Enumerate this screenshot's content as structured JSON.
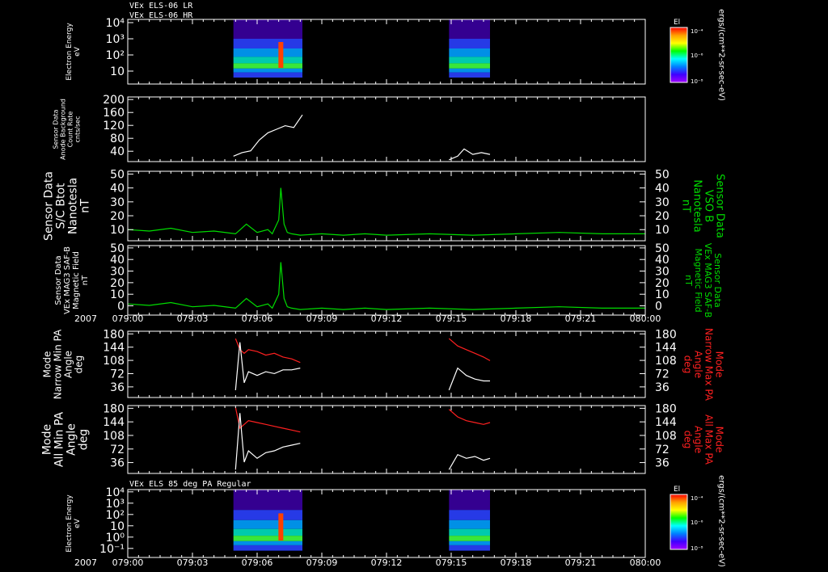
{
  "header": {
    "line1": "VEx ELS-06 LR",
    "line2": "VEx ELS-06 HR",
    "panel7_title": "VEx ELS 85 deg PA Regular"
  },
  "colors": {
    "background": "#000000",
    "axis": "#ffffff",
    "magnetic": "#00dd00",
    "max_pa": "#ff2020",
    "min_pa": "#ffffff"
  },
  "time_axis": {
    "start": "079:00",
    "end": "080:00",
    "year_label": "2007",
    "tick_labels": [
      "079:00",
      "079:03",
      "079:06",
      "079:09",
      "079:12",
      "079:15",
      "079:18",
      "079:21",
      "080:00"
    ]
  },
  "colorbar": {
    "title": "El",
    "unit": "ergs/(cm**2-sr-sec-eV)",
    "ticks": [
      "10⁻⁴",
      "10⁻⁶",
      "10⁻⁸"
    ]
  },
  "chart_data": [
    {
      "id": "p1",
      "type": "heatmap",
      "ylabel": [
        "Electron Energy",
        "eV"
      ],
      "y_ticks": [
        "10⁴",
        "10³",
        "10²",
        "10"
      ],
      "ylim": [
        1,
        20000
      ],
      "scale": "log",
      "data_intervals_minutes": [
        [
          4.9,
          8.1
        ],
        [
          14.9,
          16.8
        ]
      ]
    },
    {
      "id": "p2",
      "type": "line",
      "ylabel": [
        "Sensor Data",
        "Anode Background",
        "Count Rate",
        "cnts/sec"
      ],
      "y_ticks": [
        "200",
        "160",
        "120",
        "80",
        "40"
      ],
      "ylim": [
        20,
        200
      ],
      "series": [
        {
          "color": "#ffffff",
          "segments": [
            {
              "x": [
                4.9,
                5.3,
                5.7,
                6.1,
                6.5,
                6.9,
                7.3,
                7.7,
                8.1
              ],
              "y": [
                35,
                45,
                50,
                80,
                100,
                110,
                120,
                115,
                150
              ]
            },
            {
              "x": [
                14.9,
                15.3,
                15.6,
                16.0,
                16.4,
                16.8
              ],
              "y": [
                25,
                35,
                55,
                40,
                45,
                40
              ]
            }
          ]
        }
      ]
    },
    {
      "id": "p3",
      "type": "line",
      "ylabel": [
        "Sensor Data",
        "S/C Btot",
        "Nanotesla",
        "nT"
      ],
      "ylabel_right": [
        "Sensor Data",
        "VSO B",
        "Nanotesla",
        "nT"
      ],
      "y_ticks": [
        "50",
        "40",
        "30",
        "20",
        "10"
      ],
      "ylim": [
        0,
        50
      ],
      "series": [
        {
          "color": "#00dd00",
          "x": [
            0,
            1,
            2,
            3,
            4,
            5,
            5.5,
            6,
            6.5,
            6.7,
            7.0,
            7.1,
            7.25,
            7.4,
            7.6,
            8,
            9,
            10,
            11,
            12,
            14,
            16,
            18,
            20,
            22,
            24
          ],
          "y": [
            8,
            7,
            9,
            6,
            7,
            5,
            12,
            6,
            8,
            5,
            15,
            38,
            12,
            6,
            5,
            4,
            5,
            4,
            5,
            4,
            5,
            4,
            5,
            6,
            5,
            5
          ]
        }
      ]
    },
    {
      "id": "p4",
      "type": "line",
      "ylabel": [
        "Sensor Data",
        "VEx MAG3 SAF-B",
        "Magnetic Field",
        "nT"
      ],
      "ylabel_right": [
        "Sensor Data",
        "VEx MAG3 SAF-B",
        "Magnetic Field",
        "nT"
      ],
      "y_ticks": [
        "50",
        "40",
        "30",
        "20",
        "10",
        "0"
      ],
      "ylim": [
        0,
        50
      ],
      "series": [
        {
          "color": "#00dd00",
          "x": [
            0,
            1,
            2,
            3,
            4,
            5,
            5.5,
            6,
            6.5,
            6.7,
            7.0,
            7.1,
            7.25,
            7.4,
            7.6,
            8,
            9,
            10,
            11,
            12,
            14,
            16,
            18,
            20,
            22,
            24
          ],
          "y": [
            8,
            7,
            9,
            6,
            7,
            5,
            12,
            6,
            8,
            5,
            15,
            38,
            12,
            6,
            5,
            4,
            5,
            4,
            5,
            4,
            5,
            4,
            5,
            6,
            5,
            5
          ]
        }
      ]
    },
    {
      "id": "p5",
      "type": "line",
      "ylabel": [
        "Mode",
        "Narrow Min PA",
        "Angle",
        "deg"
      ],
      "ylabel_right": [
        "Mode",
        "Narrow Max PA",
        "Angle",
        "deg"
      ],
      "y_ticks": [
        "180",
        "144",
        "108",
        "72",
        "36"
      ],
      "ylim": [
        0,
        180
      ],
      "series": [
        {
          "color": "#ff2020",
          "segments": [
            {
              "x": [
                5.0,
                5.2,
                5.4,
                5.6,
                6.0,
                6.4,
                6.8,
                7.2,
                7.6,
                8.0
              ],
              "y": [
                160,
                130,
                120,
                130,
                125,
                115,
                120,
                110,
                105,
                95
              ]
            },
            {
              "x": [
                14.9,
                15.3,
                15.7,
                16.1,
                16.5,
                16.8
              ],
              "y": [
                160,
                140,
                130,
                120,
                110,
                100
              ]
            }
          ]
        },
        {
          "color": "#ffffff",
          "segments": [
            {
              "x": [
                5.0,
                5.2,
                5.4,
                5.6,
                6.0,
                6.4,
                6.8,
                7.2,
                7.6,
                8.0
              ],
              "y": [
                20,
                150,
                40,
                70,
                60,
                70,
                65,
                75,
                75,
                80
              ]
            },
            {
              "x": [
                14.9,
                15.3,
                15.7,
                16.1,
                16.5,
                16.8
              ],
              "y": [
                20,
                80,
                60,
                50,
                45,
                45
              ]
            }
          ]
        }
      ]
    },
    {
      "id": "p6",
      "type": "line",
      "ylabel": [
        "Mode",
        "All Min PA",
        "Angle",
        "deg"
      ],
      "ylabel_right": [
        "Mode",
        "All Max PA",
        "Angle",
        "deg"
      ],
      "y_ticks": [
        "180",
        "144",
        "108",
        "72",
        "36"
      ],
      "ylim": [
        0,
        180
      ],
      "series": [
        {
          "color": "#ff2020",
          "segments": [
            {
              "x": [
                5.0,
                5.2,
                5.4,
                5.6,
                6.0,
                6.4,
                6.8,
                7.2,
                7.6,
                8.0
              ],
              "y": [
                175,
                120,
                130,
                140,
                135,
                130,
                125,
                120,
                115,
                110
              ]
            },
            {
              "x": [
                14.9,
                15.3,
                15.7,
                16.1,
                16.5,
                16.8
              ],
              "y": [
                170,
                150,
                140,
                135,
                130,
                135
              ]
            }
          ]
        },
        {
          "color": "#ffffff",
          "segments": [
            {
              "x": [
                5.0,
                5.2,
                5.4,
                5.6,
                6.0,
                6.4,
                6.8,
                7.2,
                7.6,
                8.0
              ],
              "y": [
                10,
                160,
                30,
                60,
                40,
                55,
                60,
                70,
                75,
                80
              ]
            },
            {
              "x": [
                14.9,
                15.3,
                15.7,
                16.1,
                16.5,
                16.8
              ],
              "y": [
                10,
                50,
                40,
                45,
                35,
                40
              ]
            }
          ]
        }
      ]
    },
    {
      "id": "p7",
      "type": "heatmap",
      "ylabel": [
        "Electron Energy",
        "eV"
      ],
      "y_ticks": [
        "10⁴",
        "10³",
        "10²",
        "10",
        "10⁰",
        "10⁻¹"
      ],
      "ylim": [
        0.1,
        20000
      ],
      "scale": "log",
      "data_intervals_minutes": [
        [
          4.9,
          8.1
        ],
        [
          14.9,
          16.8
        ]
      ]
    }
  ]
}
